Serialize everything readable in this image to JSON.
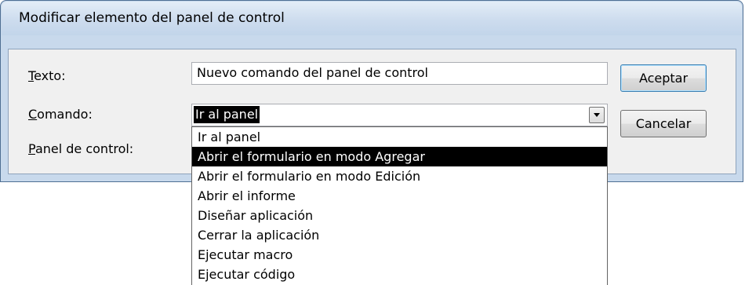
{
  "window": {
    "title": "Modificar elemento del panel de control"
  },
  "form": {
    "texto_label": "Texto:",
    "texto_value": "Nuevo comando del panel de control",
    "comando_label": "Comando:",
    "comando_value": "Ir al panel",
    "panel_label": "Panel de control:"
  },
  "buttons": {
    "accept": "Aceptar",
    "cancel": "Cancelar"
  },
  "dropdown": {
    "options": [
      "Ir al panel",
      "Abrir el formulario en modo Agregar",
      "Abrir el formulario en modo Edición",
      "Abrir el informe",
      "Diseñar aplicación",
      "Cerrar la aplicación",
      "Ejecutar macro",
      "Ejecutar código"
    ],
    "highlighted_index": 1
  },
  "icons": {
    "combo_arrow": "chevron-down-icon"
  }
}
